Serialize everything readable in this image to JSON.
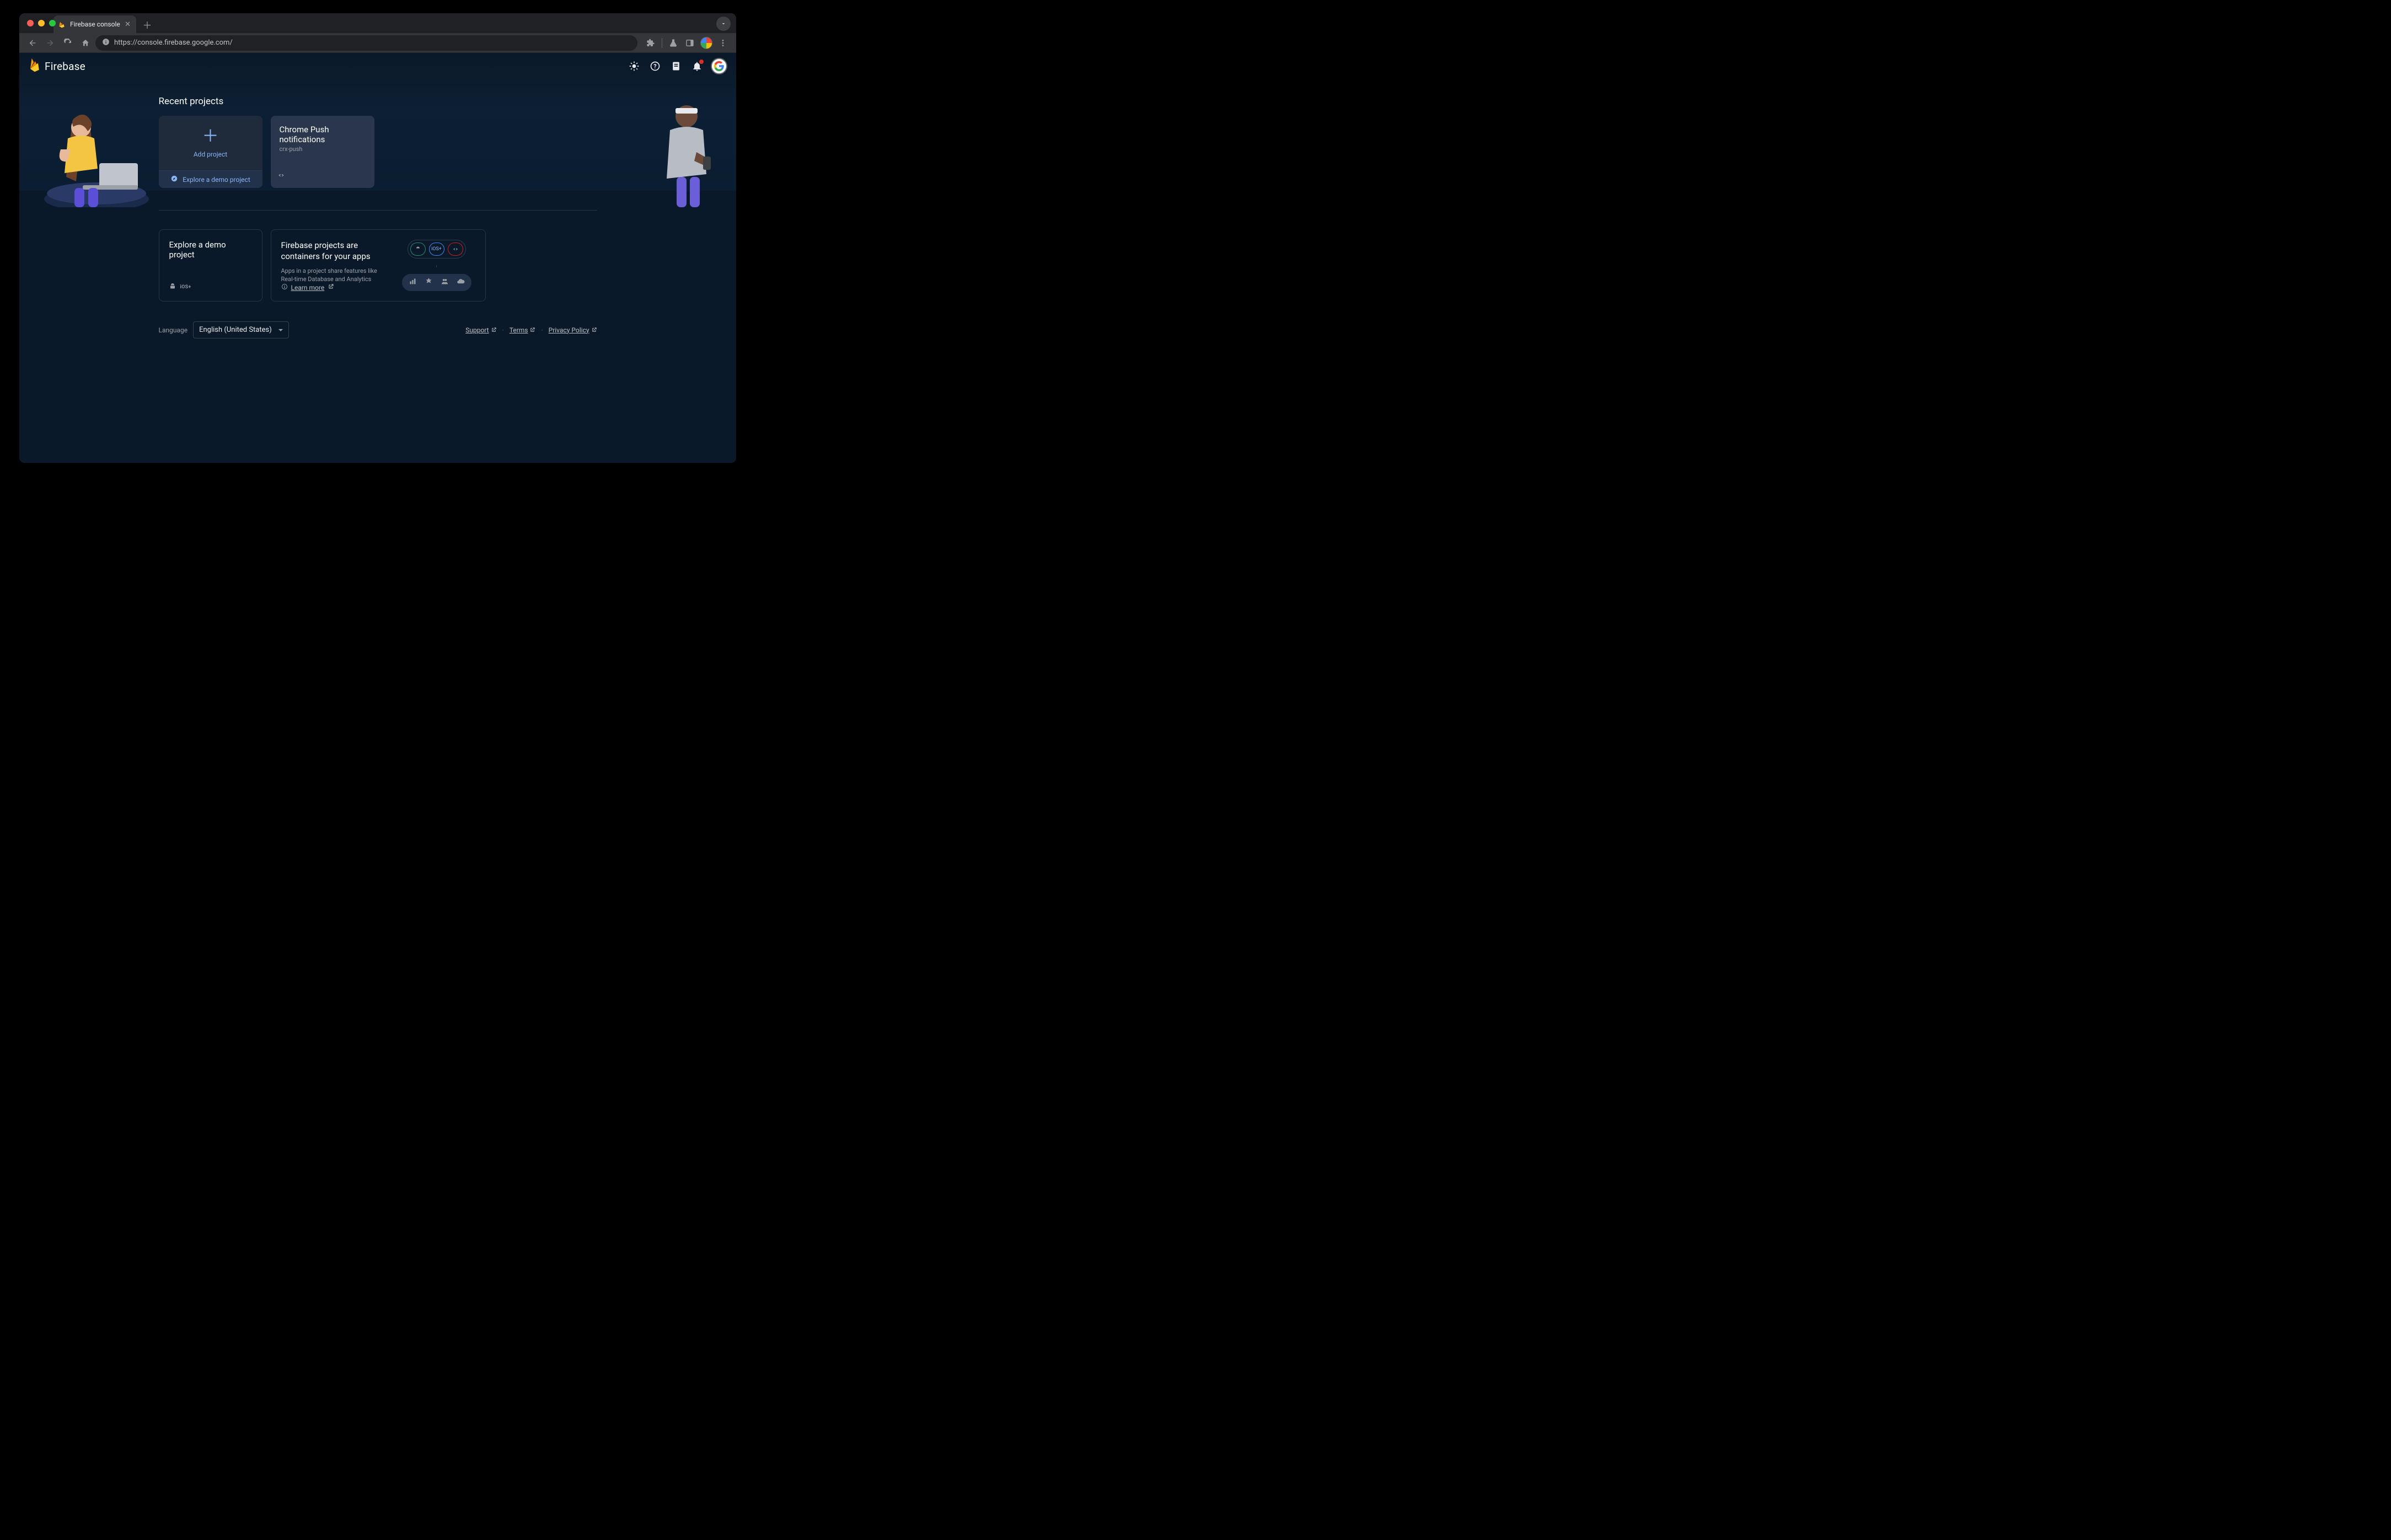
{
  "browser": {
    "tab_title": "Firebase console",
    "url": "https://console.firebase.google.com/"
  },
  "header": {
    "brand": "Firebase"
  },
  "sections": {
    "recent_title": "Recent projects",
    "add_label": "Add project",
    "explore_demo_link": "Explore a demo project",
    "project": {
      "name": "Chrome Push notifications",
      "id": "crx-push"
    },
    "demo_card_title": "Explore a demo project",
    "demo_ios_label": "iOS+",
    "containers_title": "Firebase projects are containers for your apps",
    "containers_desc": "Apps in a project share features like Real-time Database and Analytics",
    "learn_more": "Learn more",
    "ios_pill_label": "iOS+"
  },
  "footer": {
    "language_label": "Language",
    "language_value": "English (United States)",
    "support": "Support",
    "terms": "Terms",
    "privacy": "Privacy Policy"
  }
}
